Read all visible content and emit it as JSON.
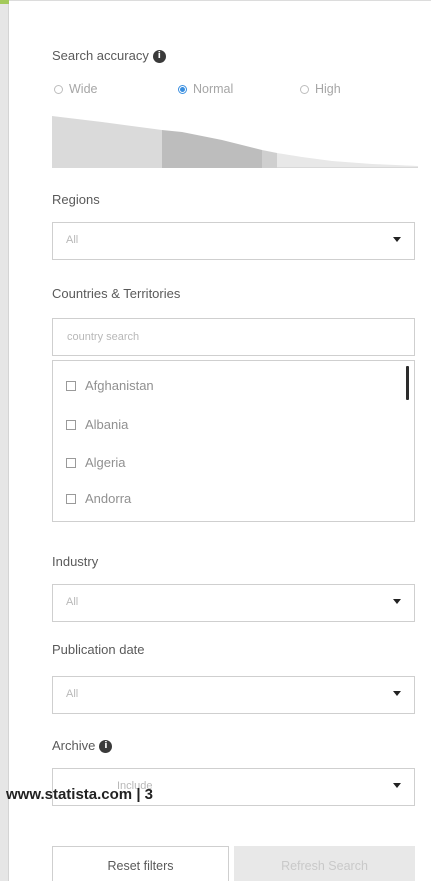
{
  "search_accuracy": {
    "label": "Search accuracy",
    "options": [
      {
        "label": "Wide",
        "checked": false
      },
      {
        "label": "Normal",
        "checked": true
      },
      {
        "label": "High",
        "checked": false
      }
    ]
  },
  "regions": {
    "label": "Regions",
    "value": "All"
  },
  "countries": {
    "label": "Countries & Territories",
    "search_placeholder": "country search",
    "items": [
      "Afghanistan",
      "Albania",
      "Algeria",
      "Andorra"
    ]
  },
  "industry": {
    "label": "Industry",
    "value": "All"
  },
  "publication_date": {
    "label": "Publication date",
    "value": "All"
  },
  "archive": {
    "label": "Archive",
    "value": "Include"
  },
  "watermark": "www.statista.com | 3",
  "buttons": {
    "reset": "Reset filters",
    "refresh": "Refresh Search"
  },
  "colors": {
    "accent": "#3a8fe0",
    "edge_accent": "#a3c95a"
  },
  "icons": {
    "info": "info-icon",
    "caret": "caret-down-icon",
    "checkbox": "checkbox-icon"
  }
}
